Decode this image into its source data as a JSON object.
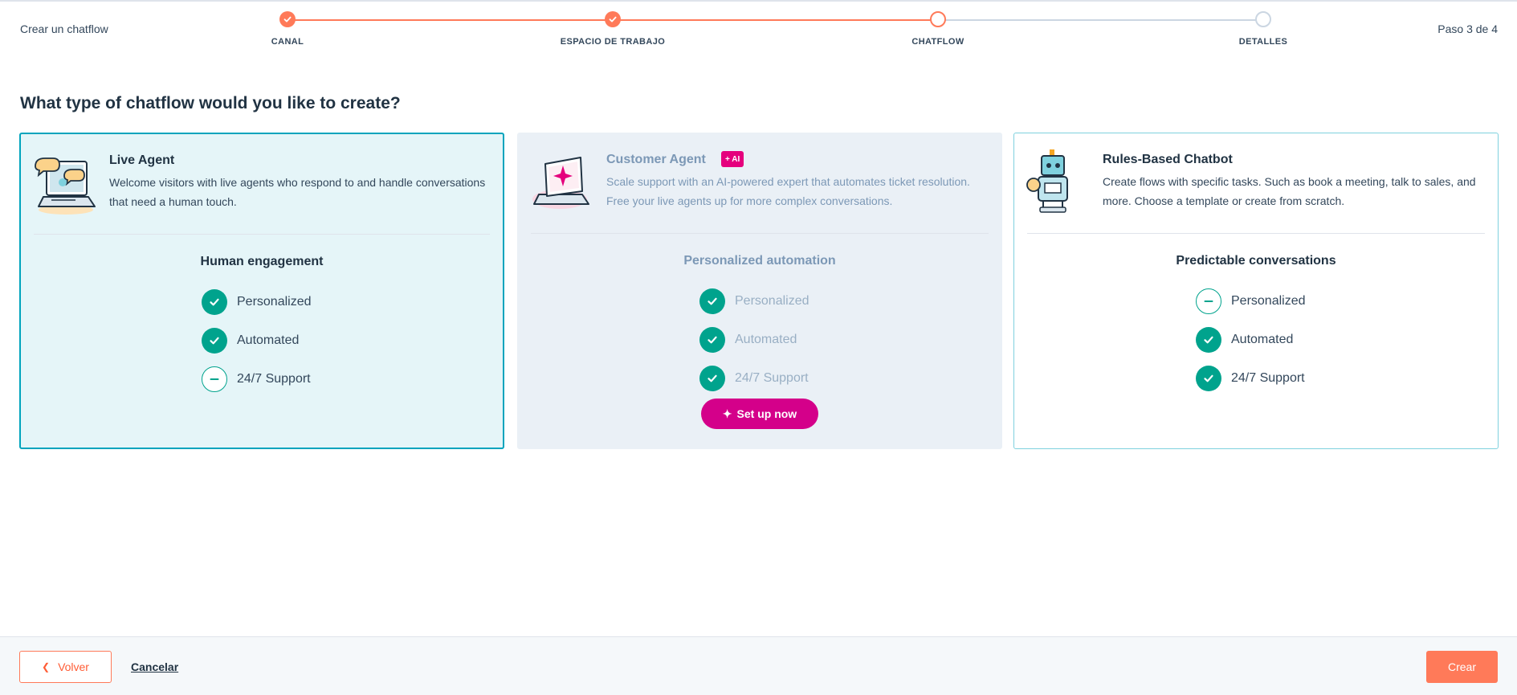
{
  "header": {
    "wizard_name": "Crear un chatflow",
    "step_count": "Paso 3 de 4",
    "steps": [
      {
        "label": "CANAL",
        "state": "done"
      },
      {
        "label": "ESPACIO DE TRABAJO",
        "state": "done"
      },
      {
        "label": "CHATFLOW",
        "state": "current"
      },
      {
        "label": "DETALLES",
        "state": "todo"
      }
    ]
  },
  "main": {
    "question": "What type of chatflow would you like to create?",
    "cards": [
      {
        "title": "Live Agent",
        "description": "Welcome visitors with live agents who respond to and handle conversations that need a human touch.",
        "feature_heading": "Human engagement",
        "features": [
          {
            "label": "Personalized",
            "included": true
          },
          {
            "label": "Automated",
            "included": true
          },
          {
            "label": "24/7 Support",
            "included": false
          }
        ],
        "selected": true,
        "icon": "laptop-chat-illustration"
      },
      {
        "title": "Customer Agent",
        "badge": "+ AI",
        "description": "Scale support with an AI-powered expert that automates ticket resolution. Free your live agents up for more complex conversations.",
        "feature_heading": "Personalized automation",
        "features": [
          {
            "label": "Personalized",
            "included": true
          },
          {
            "label": "Automated",
            "included": true
          },
          {
            "label": "24/7 Support",
            "included": true
          }
        ],
        "button_label": "Set up now",
        "disabled": true,
        "icon": "laptop-sparkle-illustration"
      },
      {
        "title": "Rules-Based Chatbot",
        "description": "Create flows with specific tasks. Such as book a meeting, talk to sales, and more. Choose a template or create from scratch.",
        "feature_heading": "Predictable conversations",
        "features": [
          {
            "label": "Personalized",
            "included": false
          },
          {
            "label": "Automated",
            "included": true
          },
          {
            "label": "24/7 Support",
            "included": true
          }
        ],
        "icon": "robot-illustration"
      }
    ]
  },
  "footer": {
    "back_label": "Volver",
    "cancel_label": "Cancelar",
    "create_label": "Crear"
  },
  "colors": {
    "accent": "#ff7a59",
    "teal_check": "#00a38d",
    "selected_border": "#00a4bd",
    "ai_pink": "#e5007d"
  }
}
